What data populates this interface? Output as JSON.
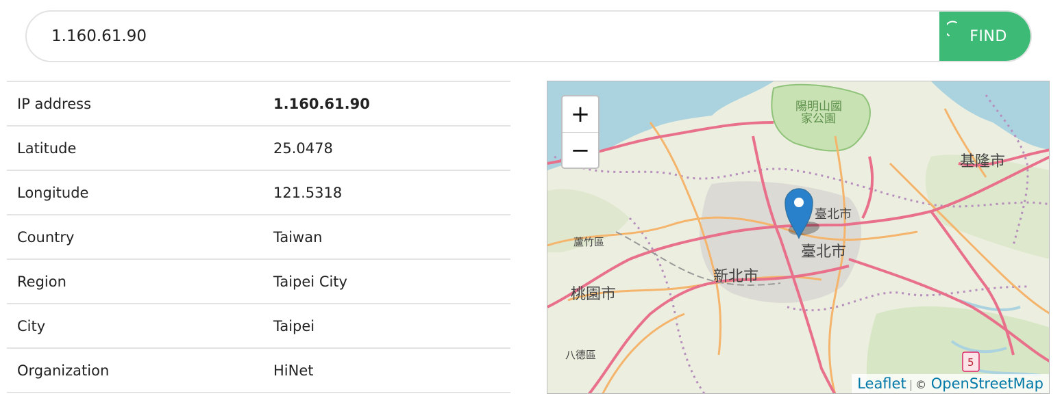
{
  "search": {
    "value": "1.160.61.90",
    "placeholder": "",
    "button_label": "FIND"
  },
  "info": {
    "rows": [
      {
        "label": "IP address",
        "value": "1.160.61.90"
      },
      {
        "label": "Latitude",
        "value": "25.0478"
      },
      {
        "label": "Longitude",
        "value": "121.5318"
      },
      {
        "label": "Country",
        "value": "Taiwan"
      },
      {
        "label": "Region",
        "value": "Taipei City"
      },
      {
        "label": "City",
        "value": "Taipei"
      },
      {
        "label": "Organization",
        "value": "HiNet"
      }
    ]
  },
  "map": {
    "zoom_in": "+",
    "zoom_out": "−",
    "labels": {
      "park": "陽明山國\n家公園",
      "keelung": "基隆市",
      "taipei_north": "臺北市",
      "taipei": "臺北市",
      "newtaipei": "新北市",
      "taoyuan": "桃園市",
      "luzhu": "蘆竹區",
      "bade": "八德區",
      "route": "5"
    },
    "attribution": {
      "leaflet": "Leaflet",
      "separator": "|",
      "copyright": "©",
      "osm": "OpenStreetMap"
    }
  },
  "colors": {
    "accent": "#3dbb76",
    "link": "#0078a8",
    "marker": "#2a81cb"
  }
}
